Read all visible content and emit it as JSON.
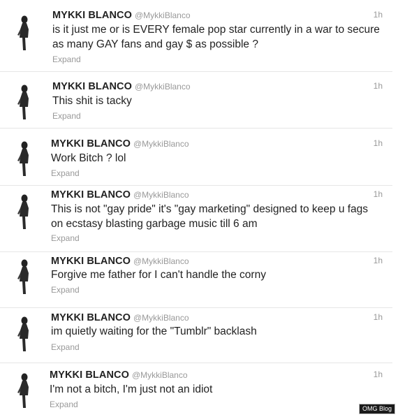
{
  "tweets": [
    {
      "name": "MYKKI BLANCO",
      "handle": "@MykkiBlanco",
      "time": "1h",
      "text": "is it just me or is EVERY female pop star currently in a war to secure as many GAY fans and gay $ as possible ?",
      "expand": "Expand"
    },
    {
      "name": "MYKKI BLANCO",
      "handle": "@MykkiBlanco",
      "time": "1h",
      "text": "This shit is tacky",
      "expand": "Expand"
    },
    {
      "name": "MYKKI BLANCO",
      "handle": "@MykkiBlanco",
      "time": "1h",
      "text": "Work Bitch ?  lol",
      "expand": "Expand"
    },
    {
      "name": "MYKKI BLANCO",
      "handle": "@MykkiBlanco",
      "time": "1h",
      "text": "This is not \"gay pride\" it's \"gay marketing\" designed to keep u fags on ecstasy blasting garbage music till 6 am",
      "expand": "Expand"
    },
    {
      "name": "MYKKI BLANCO",
      "handle": "@MykkiBlanco",
      "time": "1h",
      "text": "Forgive me father for I can't handle the corny",
      "expand": "Expand"
    },
    {
      "name": "MYKKI BLANCO",
      "handle": "@MykkiBlanco",
      "time": "1h",
      "text": "im quietly waiting for the \"Tumblr\" backlash",
      "expand": "Expand"
    },
    {
      "name": "MYKKI BLANCO",
      "handle": "@MykkiBlanco",
      "time": "1h",
      "text": "I'm not a bitch, I'm just not an idiot",
      "expand": "Expand"
    }
  ],
  "watermark": "OMG Blog",
  "colors": {
    "name": "#222222",
    "meta": "#999999",
    "divider": "#e6e6e6"
  },
  "icons": {
    "avatar": "user-photo-avatar-icon"
  }
}
